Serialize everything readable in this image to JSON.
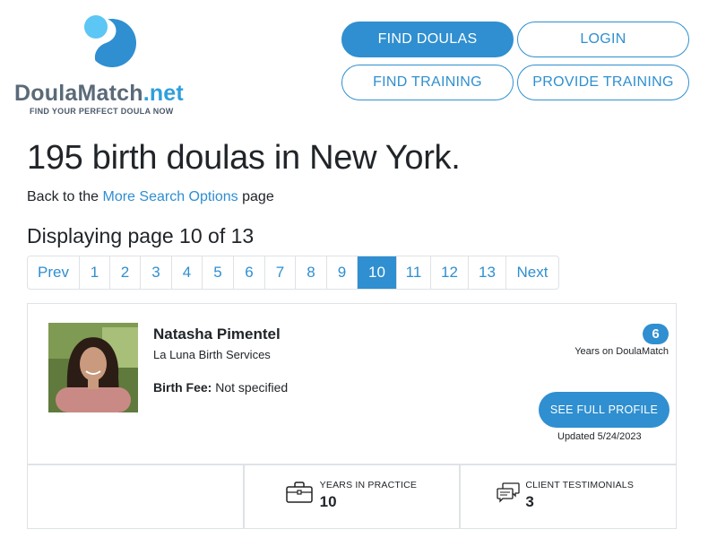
{
  "logo": {
    "name_main": "DoulaMatch",
    "name_suffix": ".net",
    "tagline": "FIND YOUR PERFECT DOULA NOW"
  },
  "nav": {
    "find_doulas": "FIND DOULAS",
    "login": "LOGIN",
    "find_training": "FIND TRAINING",
    "provide_training": "PROVIDE TRAINING"
  },
  "page": {
    "title": "195 birth doulas in New York.",
    "back_prefix": "Back to the ",
    "back_link": "More Search Options",
    "back_suffix": " page",
    "displaying": "Displaying page 10 of 13"
  },
  "pagination": {
    "prev": "Prev",
    "next": "Next",
    "pages": [
      "1",
      "2",
      "3",
      "4",
      "5",
      "6",
      "7",
      "8",
      "9",
      "10",
      "11",
      "12",
      "13"
    ],
    "current": "10"
  },
  "result": {
    "name": "Natasha Pimentel",
    "business": "La Luna Birth Services",
    "fee_label": "Birth Fee:",
    "fee_value": "Not specified",
    "years_on_site": "6",
    "years_on_site_label": "Years on DoulaMatch",
    "profile_button": "SEE FULL PROFILE",
    "updated": "Updated 5/24/2023",
    "stats": {
      "years_label": "YEARS IN PRACTICE",
      "years_value": "10",
      "testimonials_label": "CLIENT TESTIMONIALS",
      "testimonials_value": "3"
    }
  },
  "colors": {
    "accent": "#2f8fd0",
    "border": "#dfe3e6",
    "text": "#212529"
  }
}
